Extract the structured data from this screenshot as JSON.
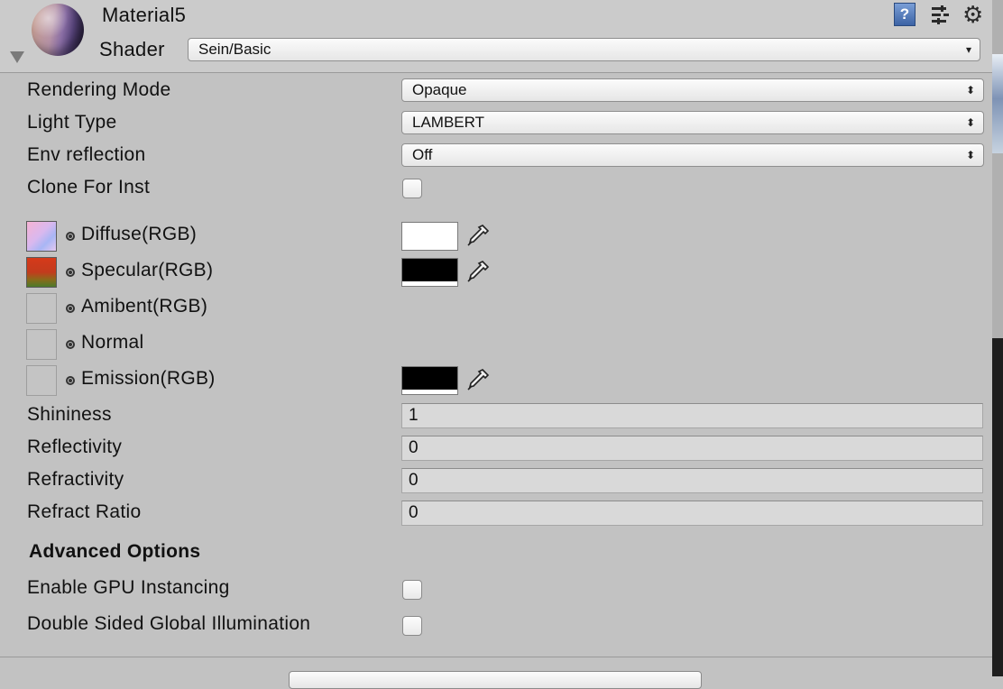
{
  "header": {
    "material_name": "Material5",
    "shader_label": "Shader",
    "shader_value": "Sein/Basic",
    "help_icon_text": "?"
  },
  "properties": [
    {
      "label": "Rendering Mode",
      "value": "Opaque"
    },
    {
      "label": "Light Type",
      "value": "LAMBERT"
    },
    {
      "label": "Env reflection",
      "value": "Off"
    },
    {
      "label": "Clone For Inst",
      "checked": false
    }
  ],
  "textures": [
    {
      "label": "Diffuse(RGB)",
      "has_texture": true,
      "color": "#ffffff"
    },
    {
      "label": "Specular(RGB)",
      "has_texture": true,
      "color": "#000000"
    },
    {
      "label": "Amibent(RGB)",
      "has_texture": false
    },
    {
      "label": "Normal",
      "has_texture": false
    },
    {
      "label": "Emission(RGB)",
      "has_texture": false,
      "color": "#000000"
    }
  ],
  "numbers": [
    {
      "label": "Shininess",
      "value": "1"
    },
    {
      "label": "Reflectivity",
      "value": "0"
    },
    {
      "label": "Refractivity",
      "value": "0"
    },
    {
      "label": "Refract Ratio",
      "value": "0"
    }
  ],
  "advanced": {
    "title": "Advanced Options",
    "items": [
      {
        "label": "Enable GPU Instancing",
        "checked": false
      },
      {
        "label": "Double Sided Global Illumination",
        "checked": false
      }
    ]
  },
  "icons": {
    "dropdown_arrow": "▾",
    "updown_arrow": "⬍",
    "gear": "⚙"
  }
}
